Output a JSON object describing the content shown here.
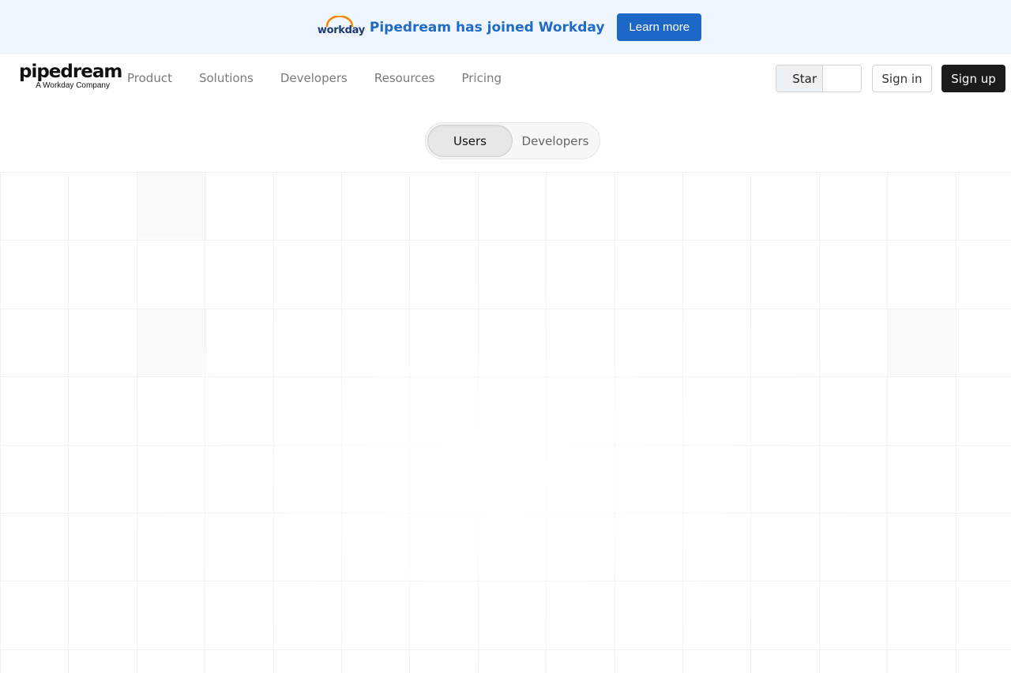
{
  "banner": {
    "logo_text": "workday",
    "message": "Pipedream has joined Workday",
    "cta_label": "Learn more",
    "logo_arc_color": "#f38b00",
    "accent_color": "#1d67c6"
  },
  "nav": {
    "brand_name": "pipedream",
    "brand_sub": "A Workday Company",
    "links": [
      {
        "label": "Product"
      },
      {
        "label": "Solutions"
      },
      {
        "label": "Developers"
      },
      {
        "label": "Resources"
      },
      {
        "label": "Pricing"
      }
    ],
    "star_label": "Star",
    "star_count": "",
    "signin_label": "Sign in",
    "signup_label": "Sign up"
  },
  "toggle": {
    "options": [
      {
        "label": "Users",
        "active": true
      },
      {
        "label": "Developers",
        "active": false
      }
    ]
  }
}
